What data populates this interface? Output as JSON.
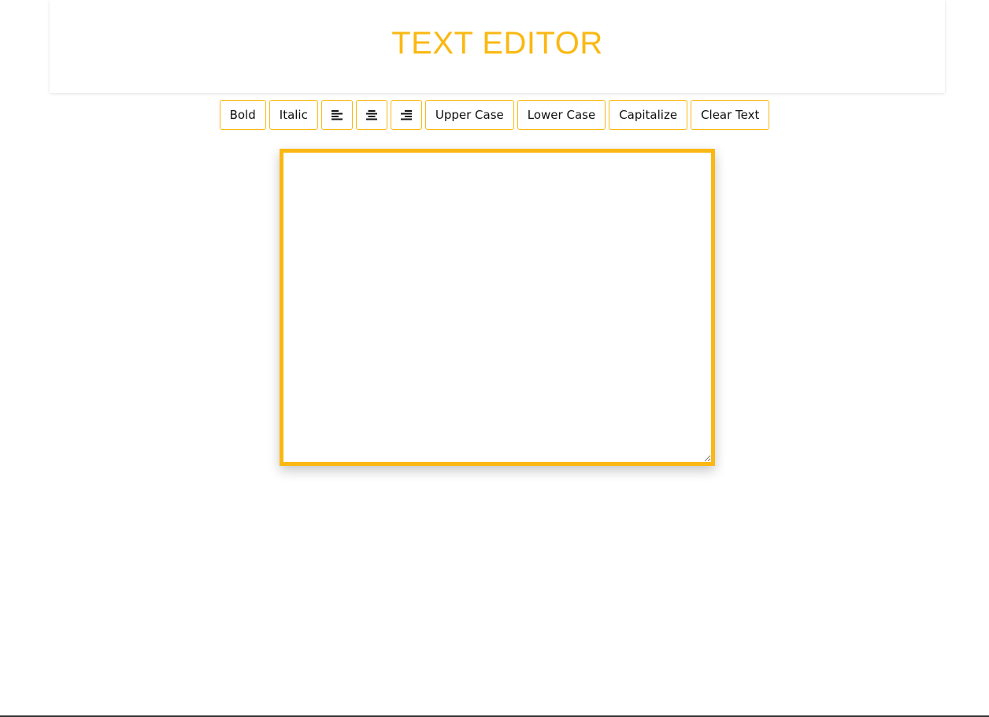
{
  "header": {
    "title": "TEXT EDITOR"
  },
  "toolbar": {
    "bold_label": "Bold",
    "italic_label": "Italic",
    "align_left_icon": "align-left-icon",
    "align_center_icon": "align-center-icon",
    "align_right_icon": "align-right-icon",
    "uppercase_label": "Upper Case",
    "lowercase_label": "Lower Case",
    "capitalize_label": "Capitalize",
    "clear_label": "Clear Text"
  },
  "editor": {
    "value": "",
    "placeholder": ""
  },
  "colors": {
    "accent": "#fbb813",
    "background": "#ffffff",
    "text": "#111111"
  }
}
